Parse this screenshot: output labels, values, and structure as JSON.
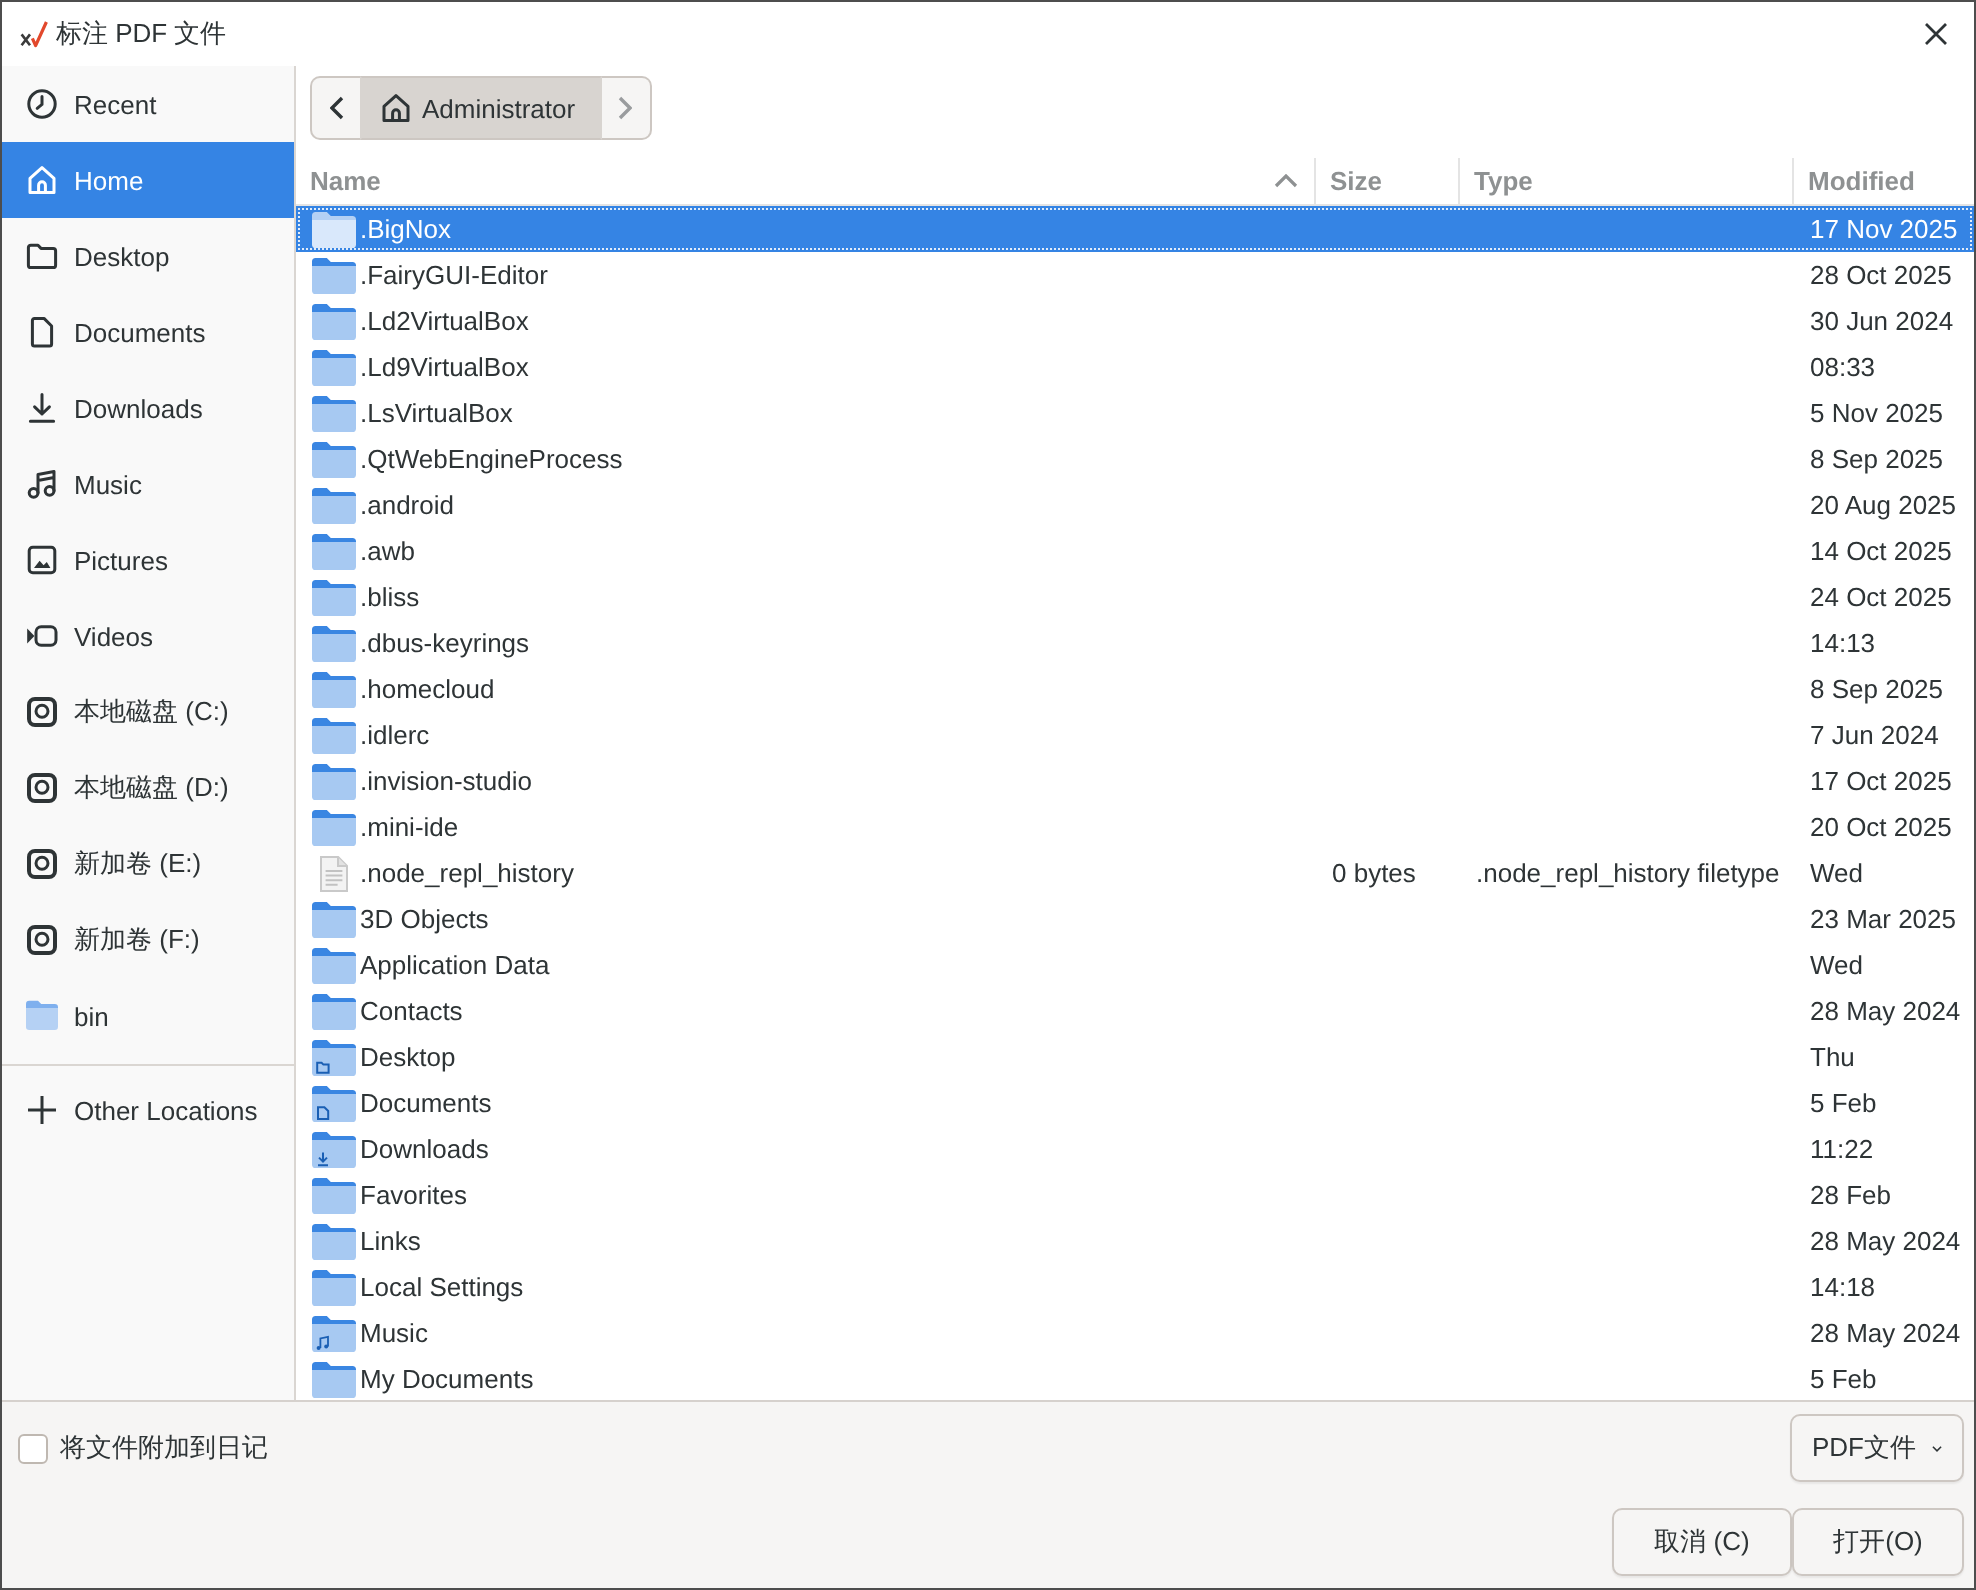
{
  "window": {
    "title": "标注 PDF 文件"
  },
  "sidebar": {
    "items": [
      {
        "label": "Recent",
        "kind": "recent",
        "selected": false
      },
      {
        "label": "Home",
        "kind": "home",
        "selected": true
      },
      {
        "label": "Desktop",
        "kind": "desktop",
        "selected": false
      },
      {
        "label": "Documents",
        "kind": "documents",
        "selected": false
      },
      {
        "label": "Downloads",
        "kind": "downloads",
        "selected": false
      },
      {
        "label": "Music",
        "kind": "music",
        "selected": false
      },
      {
        "label": "Pictures",
        "kind": "pictures",
        "selected": false
      },
      {
        "label": "Videos",
        "kind": "videos",
        "selected": false
      },
      {
        "label": "本地磁盘 (C:)",
        "kind": "drive",
        "selected": false
      },
      {
        "label": "本地磁盘 (D:)",
        "kind": "drive",
        "selected": false
      },
      {
        "label": "新加卷 (E:)",
        "kind": "drive",
        "selected": false
      },
      {
        "label": "新加卷 (F:)",
        "kind": "drive",
        "selected": false
      },
      {
        "label": "bin",
        "kind": "folder",
        "selected": false
      }
    ],
    "other_locations": {
      "label": "Other Locations"
    }
  },
  "path_bar": {
    "back": {
      "disabled": false
    },
    "segments": [
      {
        "label": "Administrator",
        "kind": "home",
        "selected": true
      }
    ],
    "forward": {
      "disabled": true
    }
  },
  "file_list": {
    "columns": [
      {
        "label": "Name",
        "sorted": true
      },
      {
        "label": "Size",
        "sorted": false
      },
      {
        "label": "Type",
        "sorted": false
      },
      {
        "label": "Modified",
        "sorted": false
      }
    ],
    "rows": [
      {
        "name": ".BigNox",
        "kind": "folder",
        "modified": "17 Nov 2025",
        "selected": true
      },
      {
        "name": ".FairyGUI-Editor",
        "kind": "folder",
        "modified": "28 Oct 2025",
        "selected": false
      },
      {
        "name": ".Ld2VirtualBox",
        "kind": "folder",
        "modified": "30 Jun 2024",
        "selected": false
      },
      {
        "name": ".Ld9VirtualBox",
        "kind": "folder",
        "modified": "08:33",
        "selected": false
      },
      {
        "name": ".LsVirtualBox",
        "kind": "folder",
        "modified": "5 Nov 2025",
        "selected": false
      },
      {
        "name": ".QtWebEngineProcess",
        "kind": "folder",
        "modified": "8 Sep 2025",
        "selected": false
      },
      {
        "name": ".android",
        "kind": "folder",
        "modified": "20 Aug 2025",
        "selected": false
      },
      {
        "name": ".awb",
        "kind": "folder",
        "modified": "14 Oct 2025",
        "selected": false
      },
      {
        "name": ".bliss",
        "kind": "folder",
        "modified": "24 Oct 2025",
        "selected": false
      },
      {
        "name": ".dbus-keyrings",
        "kind": "folder",
        "modified": "14:13",
        "selected": false
      },
      {
        "name": ".homecloud",
        "kind": "folder",
        "modified": "8 Sep 2025",
        "selected": false
      },
      {
        "name": ".idlerc",
        "kind": "folder",
        "modified": "7 Jun 2024",
        "selected": false
      },
      {
        "name": ".invision-studio",
        "kind": "folder",
        "modified": "17 Oct 2025",
        "selected": false
      },
      {
        "name": ".mini-ide",
        "kind": "folder",
        "modified": "20 Oct 2025",
        "selected": false
      },
      {
        "name": ".node_repl_history",
        "kind": "file",
        "size": "0 bytes",
        "type": ".node_repl_history filetype",
        "modified": "Wed",
        "selected": false
      },
      {
        "name": "3D Objects",
        "kind": "folder",
        "modified": "23 Mar 2025",
        "selected": false
      },
      {
        "name": "Application Data",
        "kind": "folder",
        "modified": "Wed",
        "selected": false
      },
      {
        "name": "Contacts",
        "kind": "folder",
        "modified": "28 May 2024",
        "selected": false
      },
      {
        "name": "Desktop",
        "kind": "desktop",
        "modified": "Thu",
        "selected": false
      },
      {
        "name": "Documents",
        "kind": "documents",
        "modified": "5 Feb",
        "selected": false
      },
      {
        "name": "Downloads",
        "kind": "downloads",
        "modified": "11:22",
        "selected": false
      },
      {
        "name": "Favorites",
        "kind": "folder",
        "modified": "28 Feb",
        "selected": false
      },
      {
        "name": "Links",
        "kind": "folder",
        "modified": "28 May 2024",
        "selected": false
      },
      {
        "name": "Local Settings",
        "kind": "folder",
        "modified": "14:18",
        "selected": false
      },
      {
        "name": "Music",
        "kind": "music",
        "modified": "28 May 2024",
        "selected": false
      },
      {
        "name": "My Documents",
        "kind": "folder",
        "modified": "5 Feb",
        "selected": false
      }
    ]
  },
  "footer": {
    "journal_option": {
      "label": "将文件附加到日记",
      "checked": false
    },
    "filter": {
      "label": "PDF文件"
    },
    "buttons": [
      "取消 (C)",
      "打开(O)"
    ]
  }
}
